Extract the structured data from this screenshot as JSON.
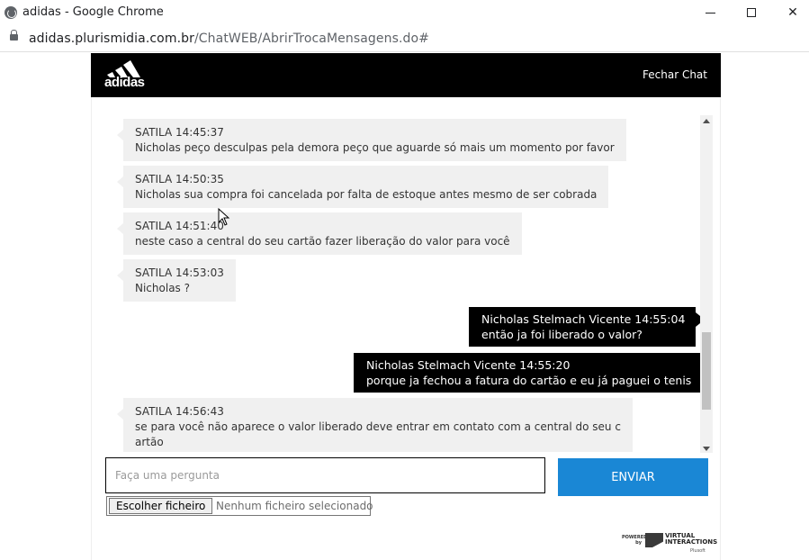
{
  "window": {
    "title": "adidas - Google Chrome",
    "minimize_glyph": "",
    "maximize_glyph": "",
    "close_glyph": "✕"
  },
  "address": {
    "host": "adidas.plurismidia.com.br",
    "path": "/ChatWEB/AbrirTrocaMensagens.do#"
  },
  "header": {
    "brand": "adidas",
    "close_label": "Fechar Chat"
  },
  "messages": [
    {
      "direction": "in",
      "meta": "SATILA 14:45:37",
      "text": "Nicholas peço desculpas pela demora peço que aguarde só mais um momento por favor"
    },
    {
      "direction": "in",
      "meta": "SATILA 14:50:35",
      "text": "Nicholas sua compra foi cancelada por falta de estoque antes mesmo de ser cobrada"
    },
    {
      "direction": "in",
      "meta": "SATILA 14:51:40",
      "text": "neste caso a central do seu cartão fazer liberação do valor para você"
    },
    {
      "direction": "in",
      "meta": "SATILA 14:53:03",
      "text": "Nicholas ?"
    },
    {
      "direction": "out",
      "meta": "Nicholas Stelmach Vicente 14:55:04",
      "text": "então ja foi liberado o valor?"
    },
    {
      "direction": "out",
      "meta": "Nicholas Stelmach Vicente 14:55:20",
      "text": "porque ja fechou a fatura do cartão e eu já paguei o tenis"
    },
    {
      "direction": "in",
      "meta": "SATILA 14:56:43",
      "text": "se para você não aparece o valor liberado deve entrar em contato com a central do seu c",
      "text2": "artão"
    }
  ],
  "composer": {
    "placeholder": "Faça uma pergunta",
    "send_label": "ENVIAR",
    "file_button_label": "Escolher ficheiro",
    "file_status": "Nenhum ficheiro selecionado"
  },
  "footer": {
    "powered_by": "POWERED by",
    "vendor": "VIRTUAL INTERACTIONS",
    "vendor_sub": "Plusoft"
  },
  "colors": {
    "header_bg": "#000000",
    "send_button": "#1a87d5",
    "incoming_bubble": "#f0f0f0",
    "outgoing_bubble": "#000000"
  }
}
